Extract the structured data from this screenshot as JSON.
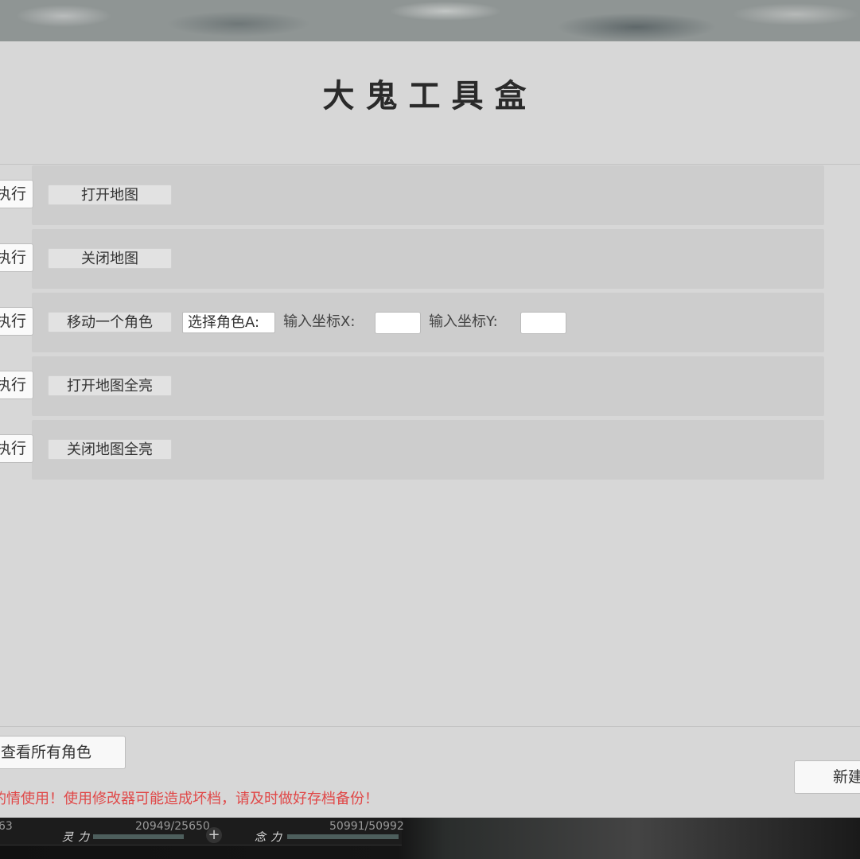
{
  "title": "大鬼工具盒",
  "exec_label": "执行",
  "rows": [
    {
      "action": "打开地图"
    },
    {
      "action": "关闭地图"
    },
    {
      "action": "移动一个角色",
      "select_value": "选择角色A:",
      "label_x": "输入坐标X:",
      "label_y": "输入坐标Y:",
      "x_value": "",
      "y_value": ""
    },
    {
      "action": "打开地图全亮"
    },
    {
      "action": "关闭地图全亮"
    }
  ],
  "view_all_button": "查看所有角色",
  "new_button": "新建",
  "warning": "酌情使用！使用修改器可能造成坏档，请及时做好存档备份！",
  "hud": {
    "left_value": "63",
    "spirit_label": "灵力",
    "spirit_value": "20949/25650",
    "mind_label": "念力",
    "mind_value": "50991/50992",
    "spirit_fraction": 0.817,
    "mind_fraction": 1.0
  }
}
